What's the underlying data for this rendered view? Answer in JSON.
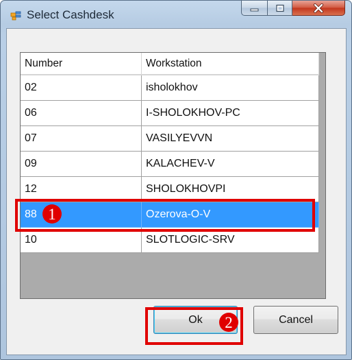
{
  "window": {
    "title": "Select Cashdesk",
    "controls": {
      "minimize": "minimize-icon",
      "maximize": "maximize-icon",
      "close": "close-icon"
    }
  },
  "grid": {
    "columns": [
      "Number",
      "Workstation"
    ],
    "rows": [
      {
        "number": "02",
        "workstation": "isholokhov"
      },
      {
        "number": "06",
        "workstation": "I-SHOLOKHOV-PC"
      },
      {
        "number": "07",
        "workstation": "VASILYEVVN"
      },
      {
        "number": "09",
        "workstation": "KALACHEV-V"
      },
      {
        "number": "12",
        "workstation": "SHOLOKHOVPI"
      },
      {
        "number": "88",
        "workstation": "Ozerova-O-V",
        "selected": true
      },
      {
        "number": "10",
        "workstation": "SLOTLOGIC-SRV"
      }
    ]
  },
  "buttons": {
    "ok": "Ok",
    "cancel": "Cancel"
  },
  "annotations": {
    "step1": "1",
    "step2": "2"
  },
  "colors": {
    "selection": "#3399ff",
    "highlight": "#e00000",
    "close_button": "#c2351d"
  }
}
